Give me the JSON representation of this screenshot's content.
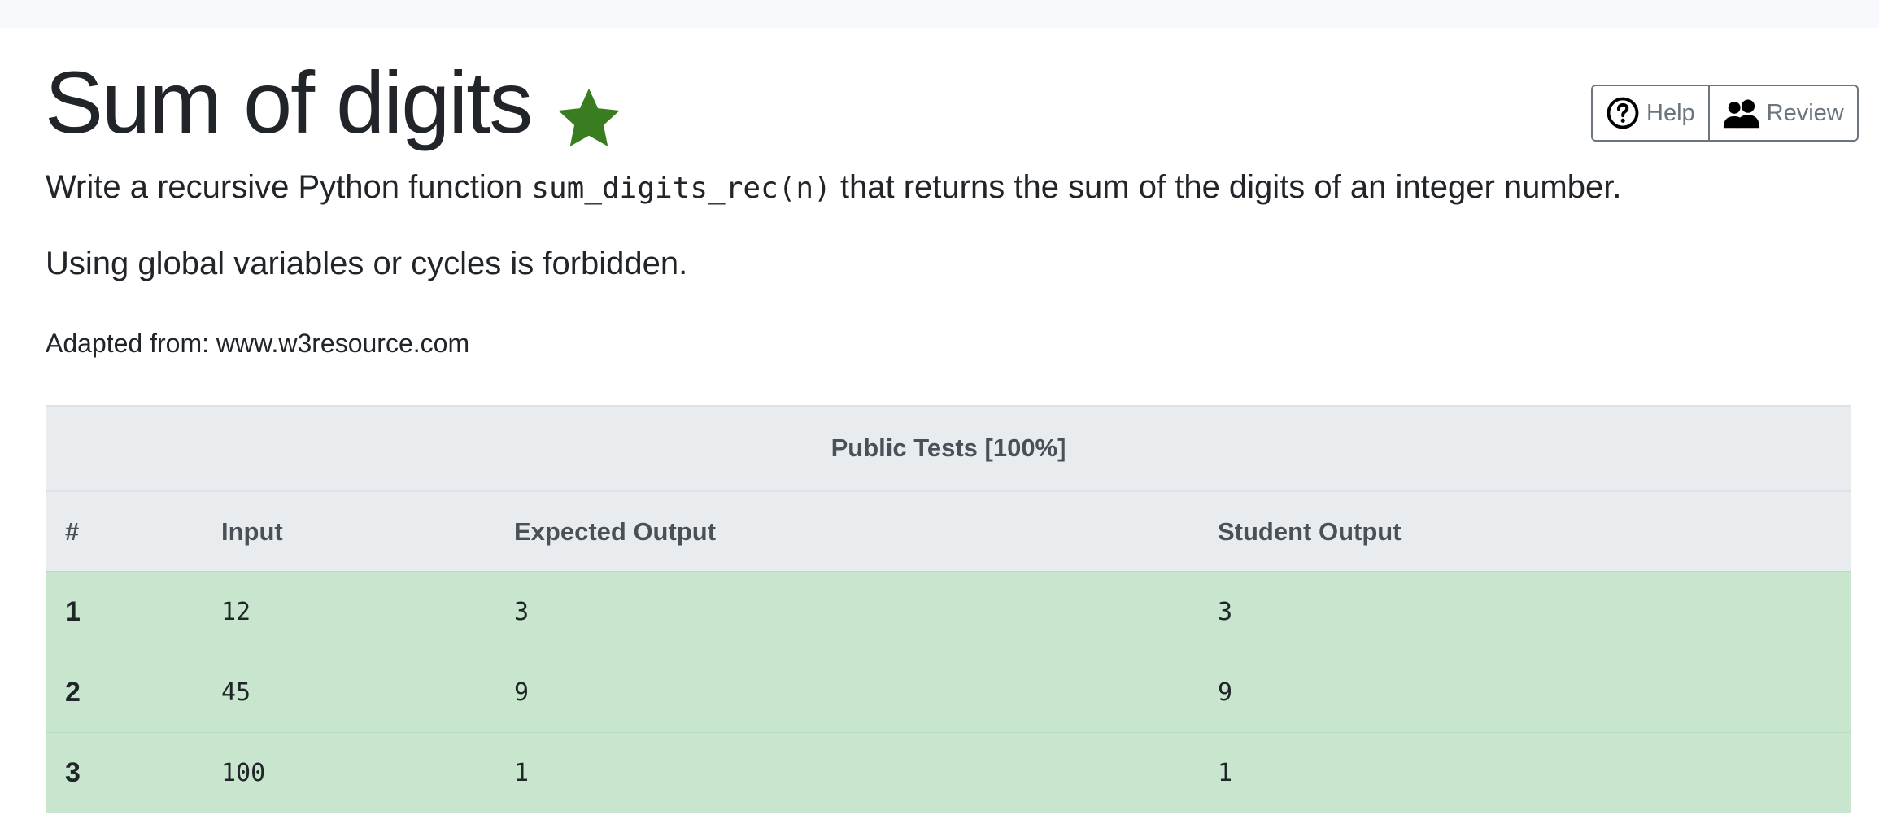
{
  "header": {
    "title": "Sum of digits",
    "star_icon": "star-icon",
    "star_color": "#3a7d20",
    "buttons": [
      {
        "label": "Help",
        "icon": "question-circle-icon"
      },
      {
        "label": "Review",
        "icon": "people-icon"
      }
    ]
  },
  "description": {
    "line1_prefix": "Write a recursive Python function ",
    "line1_code": "sum_digits_rec(n)",
    "line1_suffix": " that returns the sum of the digits of an integer number.",
    "line2": "Using global variables or cycles is forbidden.",
    "adapted": "Adapted from: www.w3resource.com"
  },
  "tests": {
    "caption": "Public Tests [100%]",
    "columns": [
      "#",
      "Input",
      "Expected Output",
      "Student Output"
    ],
    "rows": [
      {
        "num": "1",
        "input": "12",
        "expected": "3",
        "student": "3"
      },
      {
        "num": "2",
        "input": "45",
        "expected": "9",
        "student": "9"
      },
      {
        "num": "3",
        "input": "100",
        "expected": "1",
        "student": "1"
      }
    ],
    "pass_color": "#c8e6ce"
  }
}
